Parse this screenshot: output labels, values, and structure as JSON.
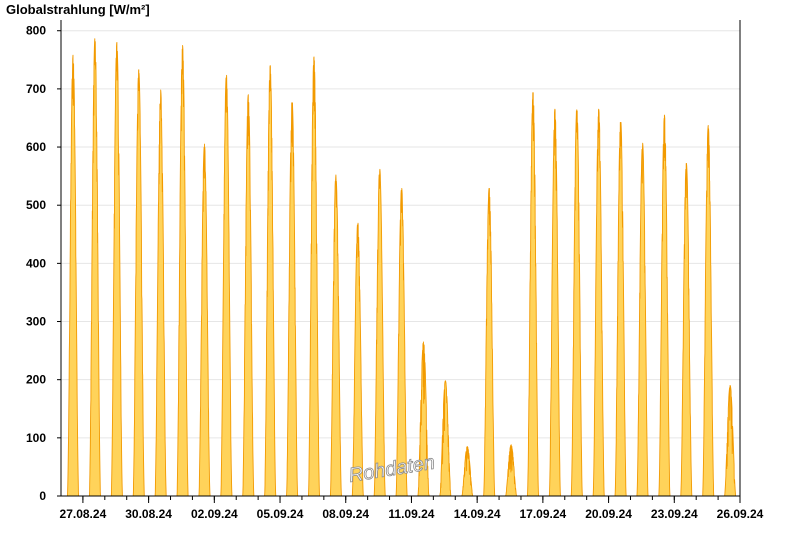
{
  "chart_data": {
    "type": "area",
    "title": "",
    "ylabel": "Globalstrahlung [W/m²]",
    "xlabel": "",
    "ylim": [
      0,
      815
    ],
    "yticks": [
      0,
      100,
      200,
      300,
      400,
      500,
      600,
      700,
      800
    ],
    "x_start": "26.08.24",
    "x_end": "26.09.24",
    "xtick_labels": [
      "27.08.24",
      "30.08.24",
      "02.09.24",
      "05.09.24",
      "08.09.24",
      "11.09.24",
      "14.09.24",
      "17.09.24",
      "20.09.24",
      "23.09.24",
      "26.09.24"
    ],
    "grid": "horizontal",
    "fill_color": "#FFD35A",
    "line_color": "#F29A00",
    "watermark": "Rohdaten",
    "daily_peaks": [
      {
        "date": "26.08.24",
        "peak": 758
      },
      {
        "date": "27.08.24",
        "peak": 788
      },
      {
        "date": "28.08.24",
        "peak": 780
      },
      {
        "date": "29.08.24",
        "peak": 733
      },
      {
        "date": "30.08.24",
        "peak": 698
      },
      {
        "date": "31.08.24",
        "peak": 775
      },
      {
        "date": "01.09.24",
        "peak": 605
      },
      {
        "date": "02.09.24",
        "peak": 725
      },
      {
        "date": "03.09.24",
        "peak": 690
      },
      {
        "date": "04.09.24",
        "peak": 740
      },
      {
        "date": "05.09.24",
        "peak": 682
      },
      {
        "date": "06.09.24",
        "peak": 755
      },
      {
        "date": "07.09.24",
        "peak": 552
      },
      {
        "date": "08.09.24",
        "peak": 470
      },
      {
        "date": "09.09.24",
        "peak": 563
      },
      {
        "date": "10.09.24",
        "peak": 530
      },
      {
        "date": "11.09.24",
        "peak": 265
      },
      {
        "date": "12.09.24",
        "peak": 198
      },
      {
        "date": "13.09.24",
        "peak": 85
      },
      {
        "date": "14.09.24",
        "peak": 530
      },
      {
        "date": "15.09.24",
        "peak": 88
      },
      {
        "date": "16.09.24",
        "peak": 695
      },
      {
        "date": "17.09.24",
        "peak": 665
      },
      {
        "date": "18.09.24",
        "peak": 668
      },
      {
        "date": "19.09.24",
        "peak": 665
      },
      {
        "date": "20.09.24",
        "peak": 648
      },
      {
        "date": "21.09.24",
        "peak": 608
      },
      {
        "date": "22.09.24",
        "peak": 655
      },
      {
        "date": "23.09.24",
        "peak": 573
      },
      {
        "date": "24.09.24",
        "peak": 637
      },
      {
        "date": "25.09.24",
        "peak": 190
      }
    ]
  }
}
